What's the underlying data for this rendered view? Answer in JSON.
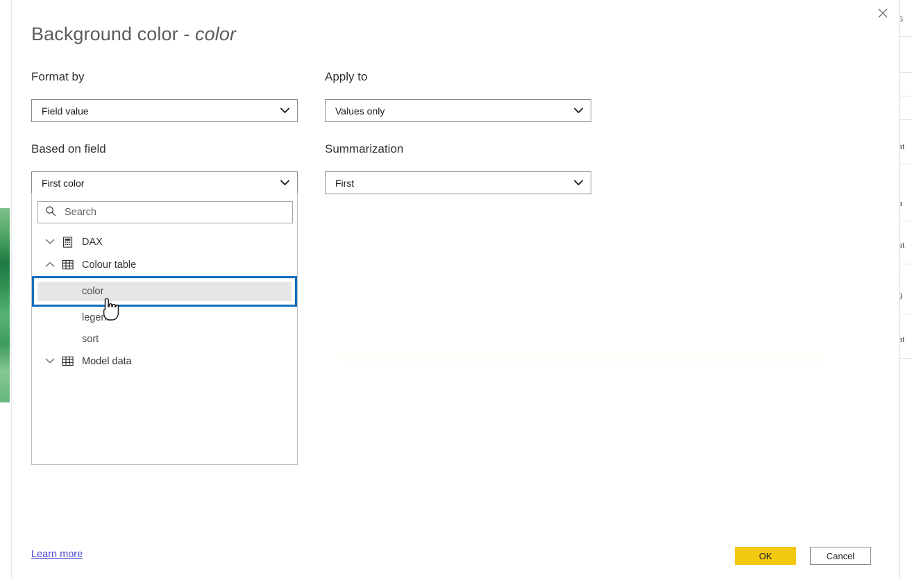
{
  "dialog": {
    "title_main": "Background color - ",
    "title_field": "color",
    "close_icon": "close-icon"
  },
  "form": {
    "format_by": {
      "label": "Format by",
      "value": "Field value",
      "chevron_icon": "chevron-down-icon"
    },
    "apply_to": {
      "label": "Apply to",
      "value": "Values only",
      "chevron_icon": "chevron-down-icon"
    },
    "based_on_field": {
      "label": "Based on field",
      "value": "First color",
      "chevron_icon": "chevron-down-icon"
    },
    "summarization": {
      "label": "Summarization",
      "value": "First",
      "chevron_icon": "chevron-down-icon"
    }
  },
  "field_picker": {
    "search": {
      "placeholder": "Search",
      "value": "",
      "icon": "search-icon"
    },
    "tree": [
      {
        "label": "DAX",
        "icon": "dax-measure-icon",
        "chevron_icon": "chevron-down-icon",
        "expanded": false,
        "children": []
      },
      {
        "label": "Colour table",
        "icon": "table-icon",
        "chevron_icon": "chevron-up-icon",
        "expanded": true,
        "children": [
          {
            "label": "color",
            "selected": true
          },
          {
            "label": "legend",
            "selected": false
          },
          {
            "label": "sort",
            "selected": false
          }
        ]
      },
      {
        "label": "Model data",
        "icon": "table-icon",
        "chevron_icon": "chevron-down-icon",
        "expanded": false,
        "children": []
      }
    ]
  },
  "footer": {
    "learn_more": "Learn more",
    "ok": "OK",
    "cancel": "Cancel"
  },
  "colors": {
    "focus_ring": "#0f6cbd",
    "selected_row": "#e6e6e6",
    "ok_button": "#f2c811",
    "link": "#4646d4",
    "title_text": "#5c5c5c",
    "border": "#8a8886"
  },
  "background": {
    "right_fragments": [
      "S",
      "at",
      "a",
      "at",
      "g",
      "at"
    ]
  }
}
